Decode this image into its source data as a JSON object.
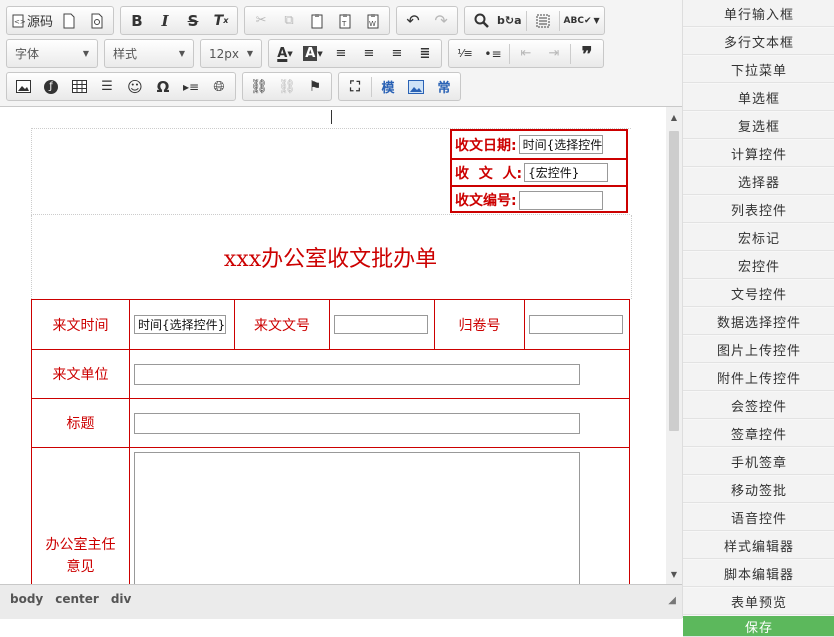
{
  "toolbar": {
    "source_label": "源码",
    "font_combo": "字体",
    "style_combo": "样式",
    "size_combo": "12px",
    "template_btn": "模",
    "common_btn": "常"
  },
  "doc": {
    "receive_date_label": "收文日期:",
    "receive_date_value": "时间{选择控件",
    "receiver_label": "收  文  人:",
    "receiver_value": "{宏控件}",
    "receive_no_label": "收文编号:",
    "title": "xxx办公室收文批办单",
    "row1": {
      "c1": "来文时间",
      "c1_value": "时间{选择控件}",
      "c2": "来文文号",
      "c3": "归卷号"
    },
    "row2": "来文单位",
    "row3": "标题",
    "row4": "办公室主任\n意见"
  },
  "statusbar": {
    "path": [
      "body",
      "center",
      "div"
    ]
  },
  "sidebar": {
    "items": [
      "单行输入框",
      "多行文本框",
      "下拉菜单",
      "单选框",
      "复选框",
      "计算控件",
      "选择器",
      "列表控件",
      "宏标记",
      "宏控件",
      "文号控件",
      "数据选择控件",
      "图片上传控件",
      "附件上传控件",
      "会签控件",
      "签章控件",
      "手机签章",
      "移动签批",
      "语音控件",
      "样式编辑器",
      "脚本编辑器",
      "表单预览"
    ],
    "save": "保存"
  },
  "colors": {
    "accent_red": "#cc0000",
    "save_green": "#5cb85c"
  }
}
